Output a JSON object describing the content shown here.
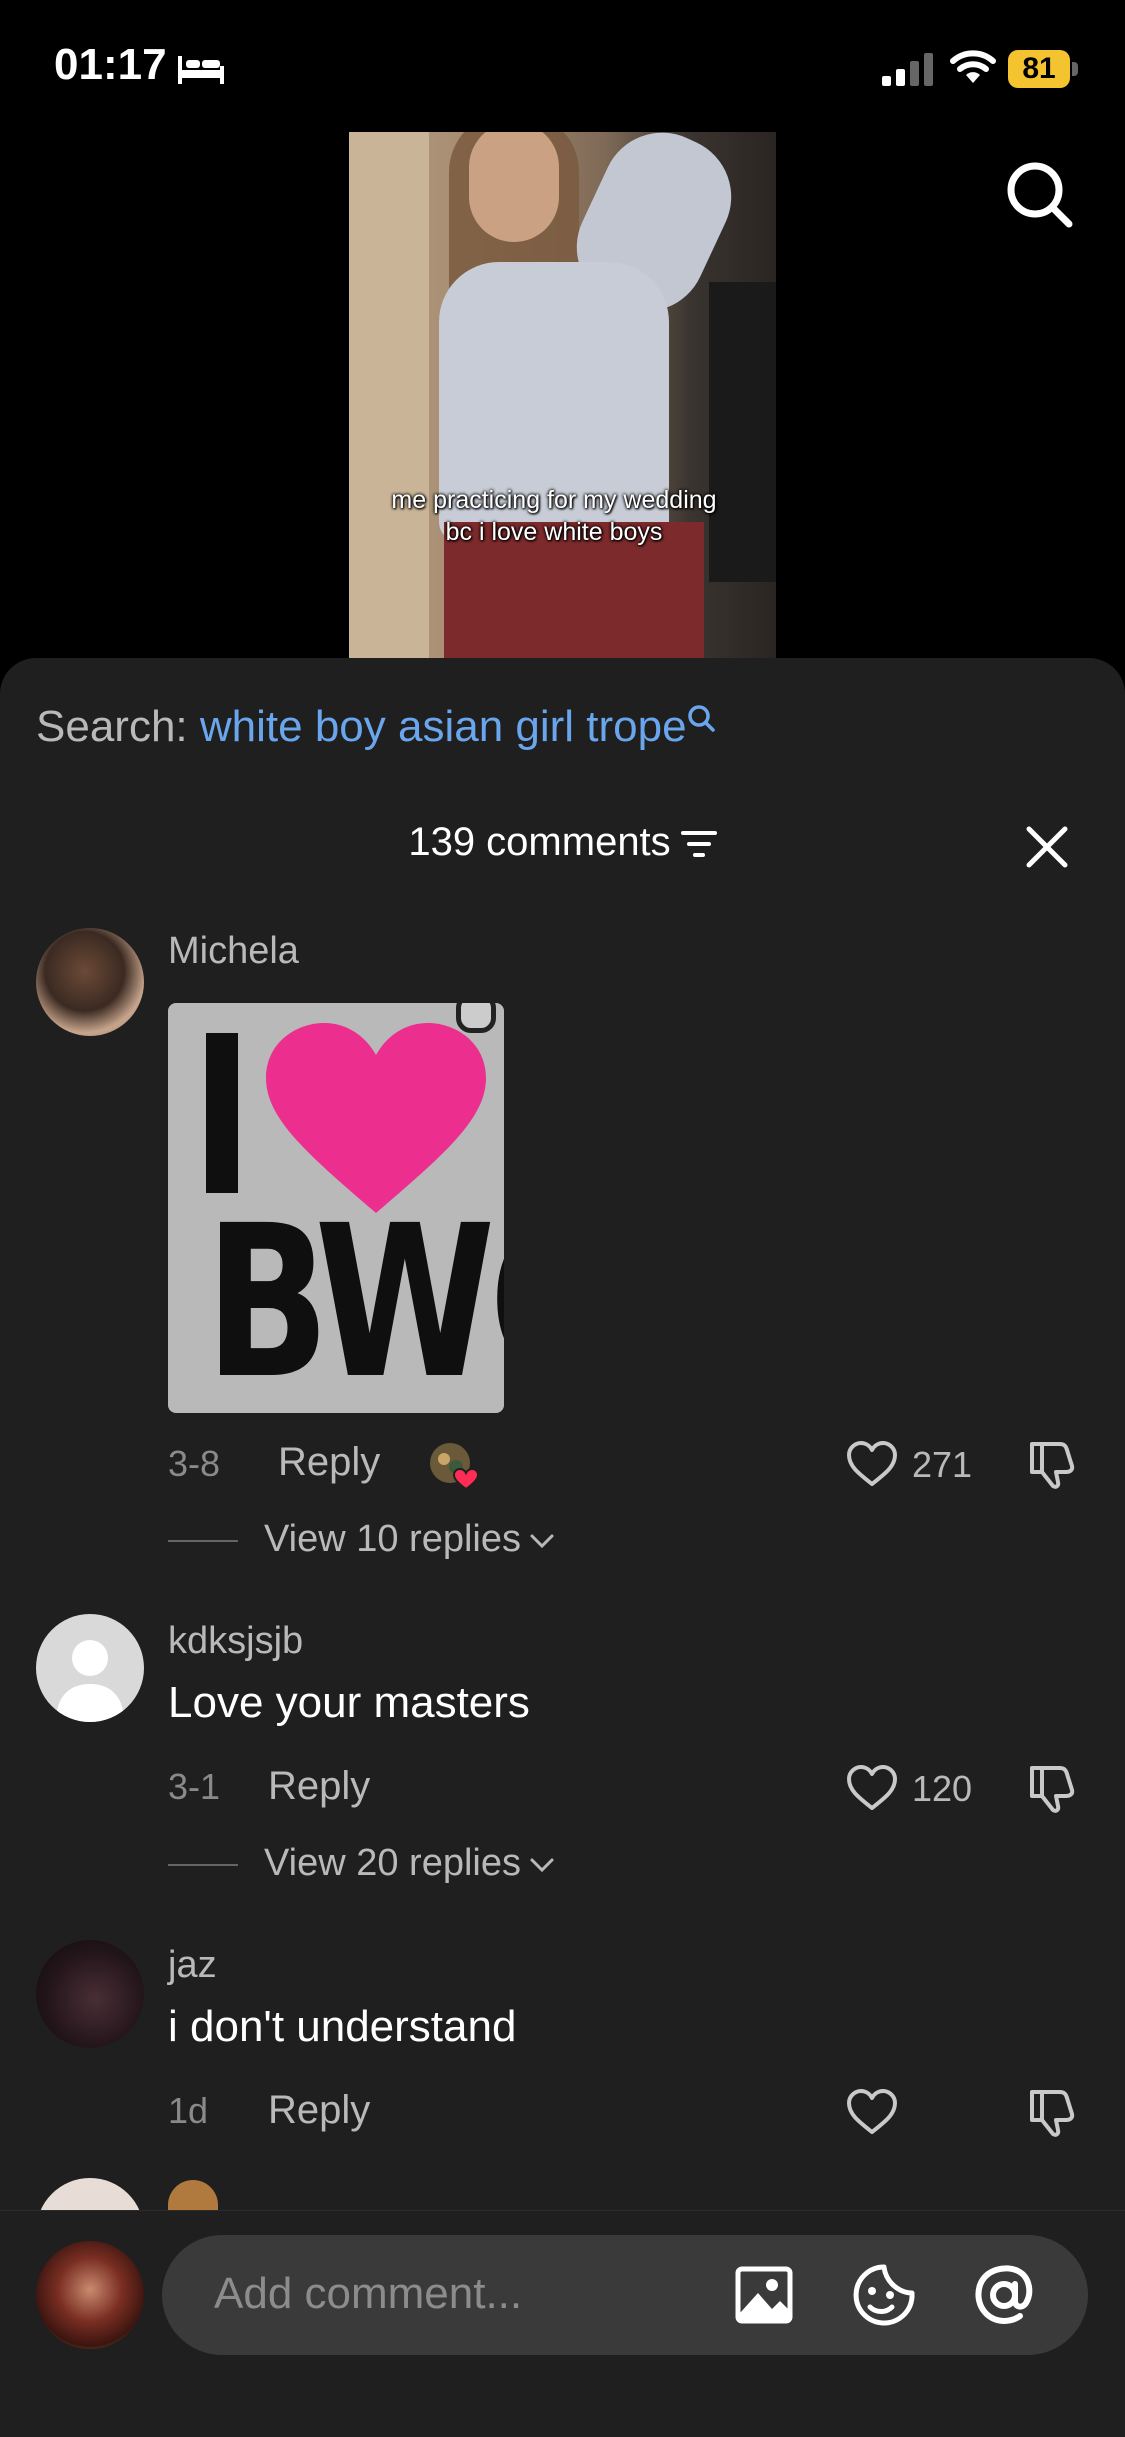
{
  "status_bar": {
    "time": "01:17",
    "battery": "81"
  },
  "video": {
    "caption": "me practicing for my wedding bc i love white boys"
  },
  "search": {
    "label": "Search:",
    "query": "white boy asian girl trope"
  },
  "comments": {
    "header": "139 comments",
    "items": [
      {
        "username": "Michela",
        "text": "",
        "date": "3-8",
        "reply": "Reply",
        "likes": "271",
        "view_replies": "View 10 replies",
        "sticker_text": "BWC",
        "sticker_letter": "I"
      },
      {
        "username": "kdksjsjb",
        "text": "Love your masters",
        "date": "3-1",
        "reply": "Reply",
        "likes": "120",
        "view_replies": "View 20 replies"
      },
      {
        "username": "jaz",
        "text": "i don't understand",
        "date": "1d",
        "reply": "Reply",
        "likes": ""
      }
    ]
  },
  "composer": {
    "placeholder": "Add comment..."
  },
  "icons": [
    "bed-icon",
    "signal-icon",
    "wifi-icon",
    "search-icon",
    "sort-icon",
    "close-icon",
    "heart-icon",
    "dislike-icon",
    "chevron-down-icon",
    "image-icon",
    "emoji-icon",
    "mention-icon"
  ],
  "colors": {
    "accent_link": "#6aa6ee",
    "battery": "#f4c430",
    "sticker_heart": "#ec2f8f",
    "sheet_bg": "#1f1f1f"
  }
}
